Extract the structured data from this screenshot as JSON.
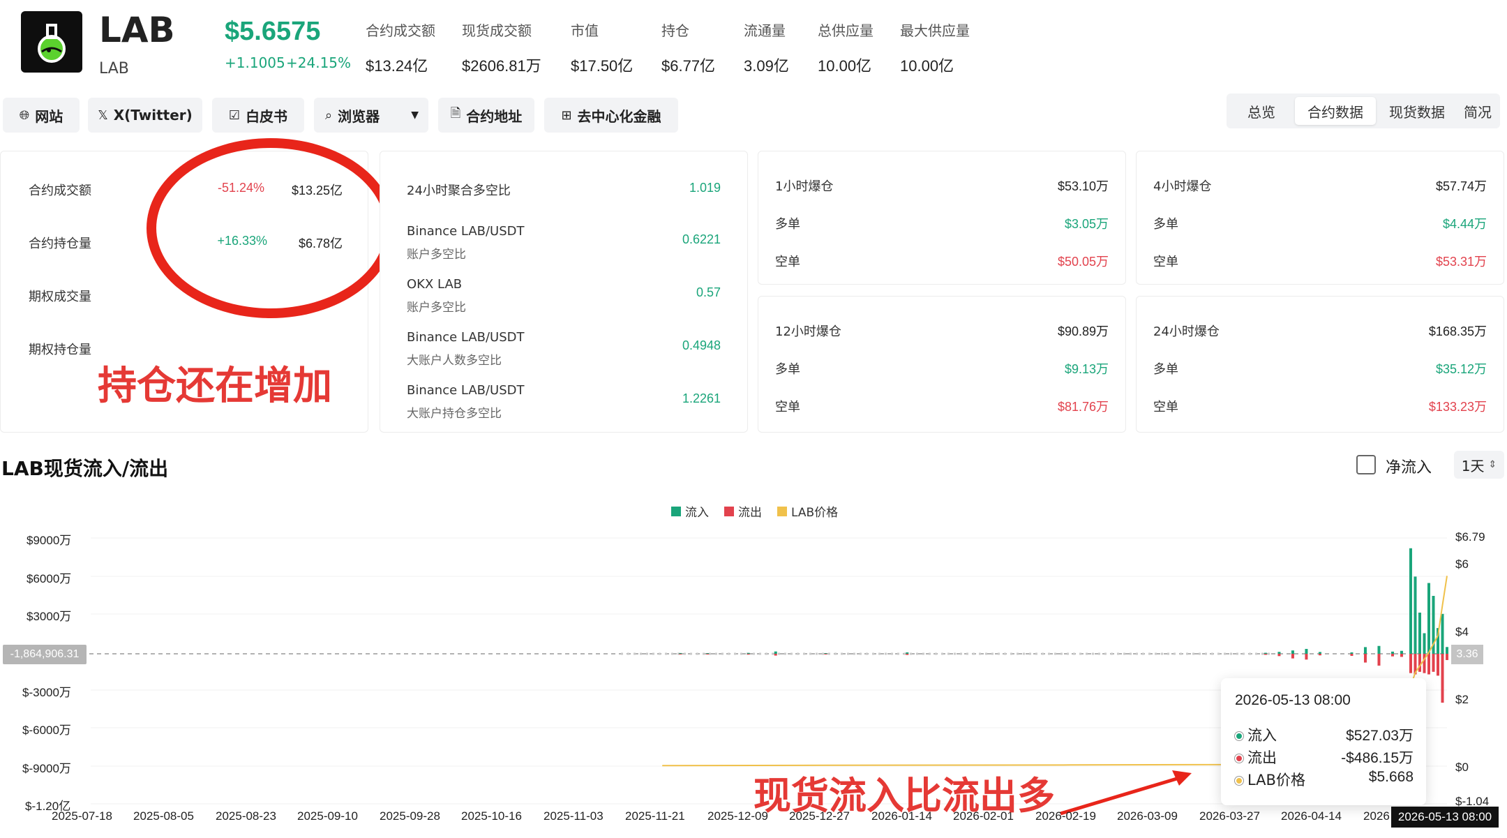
{
  "header": {
    "title": "LAB",
    "subtitle": "LAB",
    "price": "$5.6575",
    "change_abs": "+1.1005",
    "change_pct": "+24.15%",
    "stats": [
      {
        "label": "合约成交额",
        "value": "$13.24亿"
      },
      {
        "label": "现货成交额",
        "value": "$2606.81万"
      },
      {
        "label": "市值",
        "value": "$17.50亿"
      },
      {
        "label": "持仓",
        "value": "$6.77亿"
      },
      {
        "label": "流通量",
        "value": "3.09亿"
      },
      {
        "label": "总供应量",
        "value": "10.00亿"
      },
      {
        "label": "最大供应量",
        "value": "10.00亿"
      }
    ]
  },
  "toolbar": {
    "website": "网站",
    "twitter": "X(Twitter)",
    "whitepaper": "白皮书",
    "explorer": "浏览器",
    "contract": "合约地址",
    "defi": "去中心化金融"
  },
  "tabs": [
    {
      "label": "总览"
    },
    {
      "label": "合约数据"
    },
    {
      "label": "现货数据"
    },
    {
      "label": "简况"
    }
  ],
  "contract_card": {
    "rows": [
      {
        "label": "合约成交额",
        "change": "-51.24%",
        "value": "$13.25亿"
      },
      {
        "label": "合约持仓量",
        "change": "+16.33%",
        "value": "$6.78亿"
      },
      {
        "label": "期权成交量"
      },
      {
        "label": "期权持仓量"
      }
    ],
    "annotation": "持仓还在增加"
  },
  "ratio_card": {
    "rows": [
      {
        "label": "24小时聚合多空比",
        "value": "1.019"
      },
      {
        "label": "Binance LAB/USDT",
        "sub": "账户多空比",
        "value": "0.6221"
      },
      {
        "label": "OKX LAB",
        "sub": "账户多空比",
        "value": "0.57"
      },
      {
        "label": "Binance LAB/USDT",
        "sub": "大账户人数多空比",
        "value": "0.4948"
      },
      {
        "label": "Binance LAB/USDT",
        "sub": "大账户持仓多空比",
        "value": "1.2261"
      }
    ]
  },
  "liquidation_cards": [
    {
      "title": "1小时爆仓",
      "total": "$53.10万",
      "long_label": "多单",
      "long": "$3.05万",
      "short_label": "空单",
      "short": "$50.05万"
    },
    {
      "title": "4小时爆仓",
      "total": "$57.74万",
      "long_label": "多单",
      "long": "$4.44万",
      "short_label": "空单",
      "short": "$53.31万"
    },
    {
      "title": "12小时爆仓",
      "total": "$90.89万",
      "long_label": "多单",
      "long": "$9.13万",
      "short_label": "空单",
      "short": "$81.76万"
    },
    {
      "title": "24小时爆仓",
      "total": "$168.35万",
      "long_label": "多单",
      "long": "$35.12万",
      "short_label": "空单",
      "short": "$133.23万"
    }
  ],
  "flow": {
    "title": "LAB现货流入/流出",
    "net_label": "净流入",
    "period": "1天",
    "legend": {
      "inflow": "流入",
      "outflow": "流出",
      "price": "LAB价格"
    },
    "zero_badge": "-1,864,906.31",
    "right_badge": "3.36",
    "annotation": "现货流入比流出多",
    "tooltip": {
      "date": "2026-05-13 08:00",
      "inflow_label": "流入",
      "inflow": "$527.03万",
      "outflow_label": "流出",
      "outflow": "-$486.15万",
      "price_label": "LAB价格",
      "price": "$5.668"
    },
    "date_badge": "2026-05-13 08:00"
  },
  "colors": {
    "inflow": "#1aa57a",
    "outflow": "#e2424d",
    "price": "#f0c14b",
    "annotation": "#e8251a"
  },
  "chart_data": {
    "type": "bar",
    "title": "LAB现货流入/流出",
    "y_left_ticks": [
      "$9000万",
      "$6000万",
      "$3000万",
      "$-3000万",
      "$-6000万",
      "$-9000万",
      "$-1.20亿"
    ],
    "y_right_ticks": [
      "$6.79",
      "$6",
      "$4",
      "$2",
      "$0",
      "$-1.04"
    ],
    "x_ticks": [
      "2025-07-18",
      "2025-08-05",
      "2025-08-23",
      "2025-09-10",
      "2025-09-28",
      "2025-10-16",
      "2025-11-03",
      "2025-11-21",
      "2025-12-09",
      "2025-12-27",
      "2026-01-14",
      "2026-02-01",
      "2026-02-19",
      "2026-03-09",
      "2026-03-27",
      "2026-04-14",
      "2026"
    ],
    "ylim": [
      -120000000,
      95000000
    ],
    "y2lim": [
      -1.04,
      6.79
    ],
    "xlim": [
      "2025-07-18",
      "2026-05-13"
    ],
    "series": [
      {
        "name": "流入",
        "x": [
          "2025-11-25",
          "2025-12-01",
          "2025-12-10",
          "2025-12-16",
          "2025-12-27",
          "2026-01-14",
          "2026-04-03",
          "2026-04-06",
          "2026-04-09",
          "2026-04-12",
          "2026-04-15",
          "2026-04-22",
          "2026-04-25",
          "2026-04-28",
          "2026-05-01",
          "2026-05-03",
          "2026-05-05",
          "2026-05-06",
          "2026-05-07",
          "2026-05-08",
          "2026-05-09",
          "2026-05-10",
          "2026-05-11",
          "2026-05-12",
          "2026-05-13"
        ],
        "values": [
          600000,
          400000,
          700000,
          1800000,
          500000,
          1100000,
          800000,
          1500000,
          2600000,
          3800000,
          1400000,
          1100000,
          5200000,
          6100000,
          1700000,
          2300000,
          82000000,
          60000000,
          32000000,
          16000000,
          55000000,
          45000000,
          20000000,
          31000000,
          5270300
        ]
      },
      {
        "name": "流出",
        "x": [
          "2025-11-25",
          "2025-12-01",
          "2025-12-10",
          "2025-12-16",
          "2025-12-27",
          "2026-01-14",
          "2026-04-03",
          "2026-04-06",
          "2026-04-09",
          "2026-04-12",
          "2026-04-15",
          "2026-04-22",
          "2026-04-25",
          "2026-04-28",
          "2026-05-01",
          "2026-05-03",
          "2026-05-05",
          "2026-05-06",
          "2026-05-07",
          "2026-05-08",
          "2026-05-09",
          "2026-05-10",
          "2026-05-11",
          "2026-05-12",
          "2026-05-13"
        ],
        "values": [
          -500000,
          -500000,
          -600000,
          -1400000,
          -500000,
          -900000,
          -800000,
          -1800000,
          -3600000,
          -4500000,
          -1200000,
          -1600000,
          -6800000,
          -9200000,
          -2000000,
          -2400000,
          -15000000,
          -16000000,
          -14000000,
          -15000000,
          -16000000,
          -14000000,
          -17000000,
          -38000000,
          -4861500
        ]
      },
      {
        "name": "LAB价格",
        "axis": "right",
        "x": [
          "2025-11-21",
          "2025-12-27",
          "2026-02-19",
          "2026-03-27",
          "2026-04-14",
          "2026-04-28",
          "2026-05-03",
          "2026-05-06",
          "2026-05-09",
          "2026-05-11",
          "2026-05-12",
          "2026-05-13"
        ],
        "values": [
          0.05,
          0.06,
          0.07,
          0.08,
          0.2,
          0.5,
          1.6,
          2.8,
          3.4,
          3.9,
          4.8,
          5.668
        ]
      }
    ]
  }
}
